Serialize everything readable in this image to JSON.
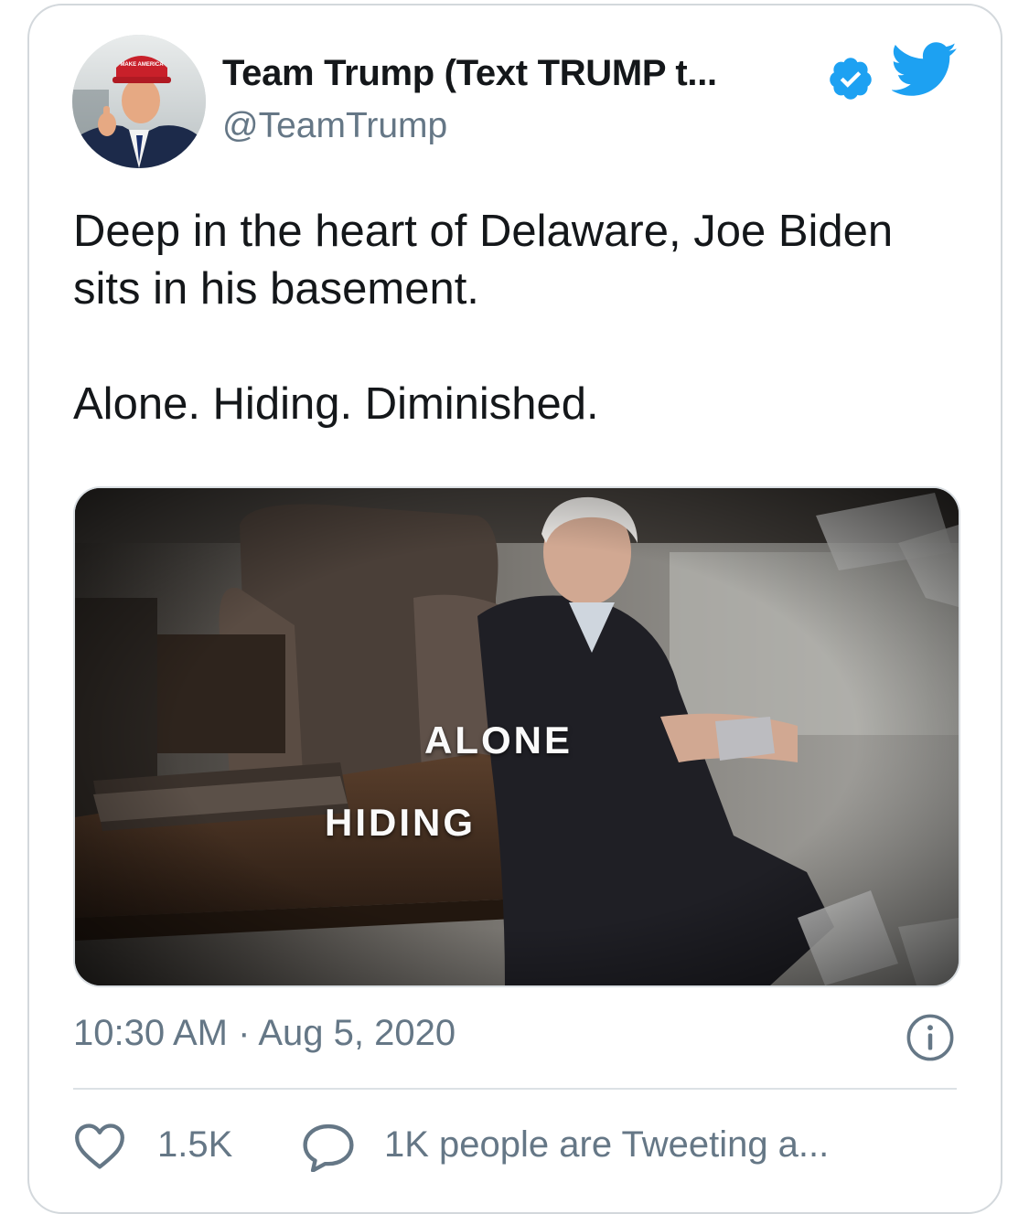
{
  "tweet": {
    "display_name": "Team Trump (Text TRUMP t...",
    "handle": "@TeamTrump",
    "avatar_icon": "profile-photo",
    "verified_icon": "verified-badge-icon",
    "platform_icon": "twitter-bird-icon",
    "text_line1": "Deep in the heart of Delaware, Joe Biden sits in his basement.",
    "text_line2": "Alone. Hiding. Diminished.",
    "media": {
      "overlay_word_1": "ALONE",
      "overlay_word_2": "HIDING"
    },
    "timestamp": "10:30 AM · Aug 5, 2020",
    "info_icon": "info-icon",
    "like_count": "1.5K",
    "reply_summary": "1K people are Tweeting a..."
  },
  "colors": {
    "accent": "#1da1f2",
    "text_primary": "#14171a",
    "text_secondary": "#657786",
    "border": "#d3d8dc"
  }
}
